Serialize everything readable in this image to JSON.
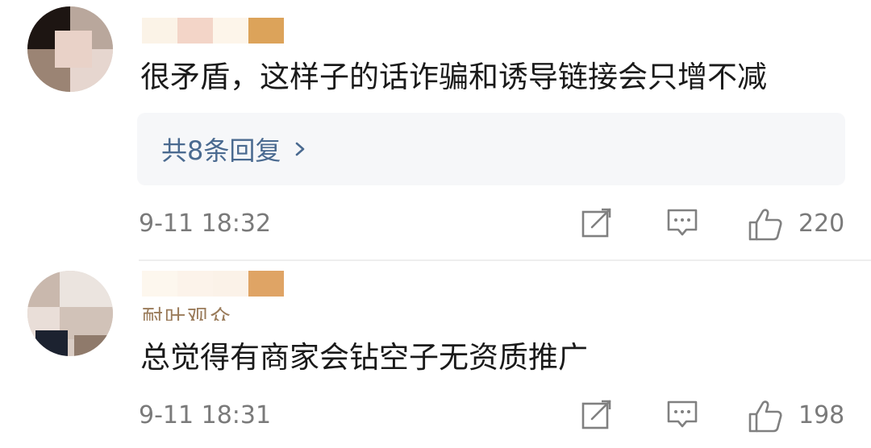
{
  "comments": [
    {
      "text": "很矛盾，这样子的话诈骗和诱导链接会只增不减",
      "replies_label": "共8条回复",
      "time": "9-11 18:32",
      "likes": "220",
      "subline": ""
    },
    {
      "text": "总觉得有商家会钻空子无资质推广",
      "replies_label": "",
      "time": "9-11 18:31",
      "likes": "198",
      "subline": "耐叶观众"
    }
  ],
  "icons": {
    "share": "share-edit-icon",
    "reply": "comment-bubble-icon",
    "like": "thumbs-up-icon",
    "chevron": "chevron-right-icon"
  },
  "colors": {
    "reply_link": "#4a6a90",
    "meta_text": "#7a7a7a",
    "reply_box_bg": "#f6f7f9"
  }
}
